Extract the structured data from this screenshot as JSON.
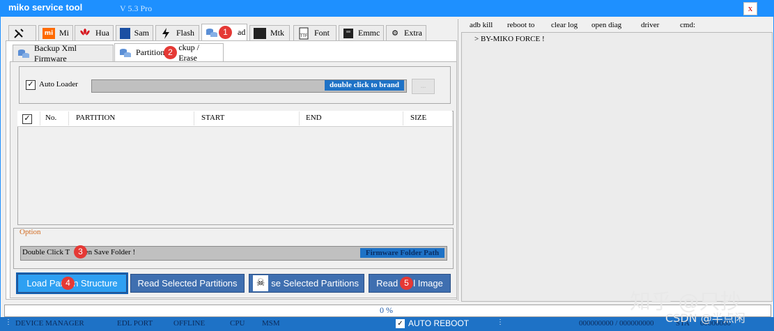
{
  "window": {
    "title": "miko service tool",
    "version": "V 5.3 Pro",
    "close_label": "x"
  },
  "main_tabs": [
    {
      "label": "",
      "icon": "wrench-icon"
    },
    {
      "label": "Mi",
      "icon": "mi-logo-icon"
    },
    {
      "label": "Hua",
      "icon": "huawei-logo-icon"
    },
    {
      "label": "Sam",
      "icon": "samsung-logo-icon"
    },
    {
      "label": "Flash",
      "icon": "lightning-icon"
    },
    {
      "label": "ad",
      "icon": "database-icon"
    },
    {
      "label": "Mtk",
      "icon": "chip-icon"
    },
    {
      "label": "Font",
      "icon": "font-file-icon"
    },
    {
      "label": "Emmc",
      "icon": "emmc-chip-icon"
    },
    {
      "label": "Extra",
      "icon": "gear-icon"
    }
  ],
  "sub_tabs": [
    {
      "label": "Backup Xml Firmware"
    },
    {
      "label": "Partition",
      "label_tail": "ckup / Erase"
    }
  ],
  "loader": {
    "checkbox_mark": "✓",
    "label": "Auto Loader",
    "brand_hint": "double click to brand",
    "folder_button": "..."
  },
  "table": {
    "check_mark": "✓",
    "columns": [
      "No.",
      "PARTITION",
      "START",
      "END",
      "SIZE"
    ]
  },
  "option": {
    "label": "Option",
    "path_text_a": "Double Click T",
    "path_text_b": "pen Save Folder !",
    "path_badge": "Firmware Folder Path"
  },
  "actions": {
    "load_a": "Load Par",
    "load_b": "n Structure",
    "read_selected": "Read Selected Partitions",
    "erase_tail": "se Selected Partitions",
    "read_a": "Read",
    "read_b": "l Image"
  },
  "badges": [
    "1",
    "2",
    "3",
    "4",
    "5"
  ],
  "log": {
    "menu": [
      "adb kill",
      "reboot to",
      "clear log",
      "open diag",
      "driver",
      "cmd:"
    ],
    "lines": [
      "> BY-MIKO FORCE !"
    ]
  },
  "progress": {
    "text": "0  %"
  },
  "status": {
    "device_manager": "DEVICE MANAGER",
    "edl_port": "EDL PORT",
    "offline": "OFFLINE",
    "cpu": "CPU",
    "msm": "MSM",
    "auto_reboot_check": "✓",
    "auto_reboot": "AUTO REBOOT",
    "counter": "000000000  /  000000000",
    "sta": "STA",
    "tail": "00000000"
  },
  "watermark": {
    "line1": "知乎 @只抄",
    "line2": "CSDN @半点闲"
  }
}
